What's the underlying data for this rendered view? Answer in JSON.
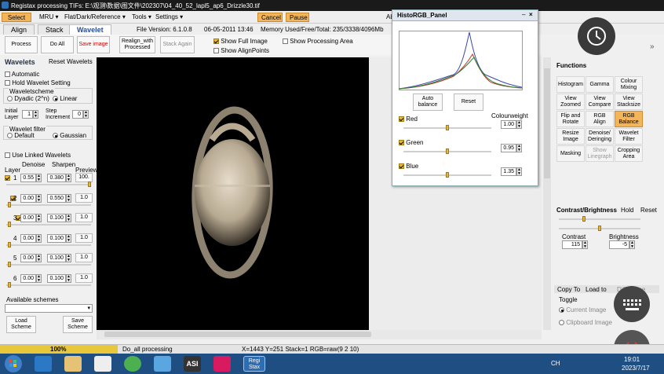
{
  "window": {
    "title": "Registax processing TIFs: E:\\观测\\数据\\图文件\\202307\\04_40_52_lapl5_ap6_Drizzle30.tif"
  },
  "menu": {
    "select": "Select",
    "mru": "MRU",
    "flat": "Flat/Dark/Reference",
    "tools": "Tools",
    "settings": "Settings",
    "cancel": "Cancel",
    "pause": "Pause",
    "about": "Ab"
  },
  "tabs": [
    "Align",
    "Stack",
    "Wavelet"
  ],
  "info": {
    "version": "File Version: 6.1.0.8",
    "datetime": "06-05-2011 13:46",
    "memory": "Memory Used/Free/Total: 235/3338/4096Mb"
  },
  "toolbar": {
    "process": "Process",
    "do_all": "Do All",
    "save_image": "Save image",
    "realign": "Realign_with\nProcessed",
    "stack_again": "Stack Again",
    "show_full_image": "Show Full Image",
    "show_alignpoints": "Show AlignPoints",
    "show_processing_area": "Show Processing Area"
  },
  "wavelets": {
    "header": "Wavelets",
    "reset": "Reset Wavelets",
    "automatic": "Automatic",
    "hold": "Hold Wavelet Setting",
    "scheme_label": "Waveletscheme",
    "dyadic": "Dyadic (2^n)",
    "linear": "Linear",
    "initial_layer_label": "Initial\nLayer",
    "initial_layer": "1",
    "step_label": "Step\nIncrement",
    "step": "0",
    "filter_label": "Wavelet filter",
    "default": "Default",
    "gaussian": "Gaussian",
    "use_linked": "Use Linked Wavelets",
    "col_layer": "Layer",
    "col_denoise": "Denoise",
    "col_sharpen": "Sharpen",
    "col_preview": "Preview",
    "layers": [
      {
        "n": "1",
        "denoise": "0.55",
        "sharpen": "0.380",
        "preview": "100."
      },
      {
        "n": "2",
        "denoise": "0.00",
        "sharpen": "0.550",
        "preview": "1.0"
      },
      {
        "n": "3",
        "denoise": "0.00",
        "sharpen": "0.100",
        "preview": "1.0"
      },
      {
        "n": "4",
        "denoise": "0.00",
        "sharpen": "0.100",
        "preview": "1.0"
      },
      {
        "n": "5",
        "denoise": "0.00",
        "sharpen": "0.100",
        "preview": "1.0"
      },
      {
        "n": "6",
        "denoise": "0.00",
        "sharpen": "0.100",
        "preview": "1.0"
      }
    ],
    "available_schemes": "Available schemes",
    "load_scheme": "Load\nScheme",
    "save_scheme": "Save\nScheme"
  },
  "histo": {
    "title": "HistoRGB_Panel",
    "auto_balance": "Auto\nbalance",
    "reset": "Reset",
    "colourweight": "Colourweight",
    "channels": [
      {
        "name": "Red",
        "value": "1.00",
        "color": "#c0392b"
      },
      {
        "name": "Green",
        "value": "0.95",
        "color": "#2e7d32"
      },
      {
        "name": "Blue",
        "value": "1.35",
        "color": "#3949ab"
      }
    ]
  },
  "functions": {
    "header": "Functions",
    "buttons": [
      "Histogram",
      "Gamma",
      "Colour\nMixing",
      "View\nZoomed",
      "View\nCompare",
      "View\nStacksize",
      "Flip and\nRotate",
      "RGB\nAlign",
      "RGB\nBalance",
      "Resize\nImage",
      "Denoise/\nDeringing",
      "Wavelet\nFilter",
      "Masking",
      "Show\nLinegraph",
      "Cropping\nArea"
    ]
  },
  "contrast": {
    "header": "Contrast/Brightness",
    "hold": "Hold",
    "reset": "Reset",
    "contrast_label": "Contrast",
    "contrast": "115",
    "brightness_label": "Brightness",
    "brightness": "-5"
  },
  "copyto": {
    "copy_to": "Copy To",
    "load_to": "Load to",
    "difference": "Difference",
    "toggle": "Toggle",
    "current_image": "Current Image",
    "clipboard_image": "Clipboard Image"
  },
  "status": {
    "progress": "100%",
    "progress_fraction": 1.0,
    "action": "Do_all processing",
    "pixel": "X=1443 Y=251 Stack=1 RGB=raw(9 2 10)"
  },
  "taskbar": {
    "lang": "CH",
    "time": "19:01",
    "date": "2023/7/17",
    "asi_label": "ASI",
    "regi_label": "Regi\nStax"
  }
}
